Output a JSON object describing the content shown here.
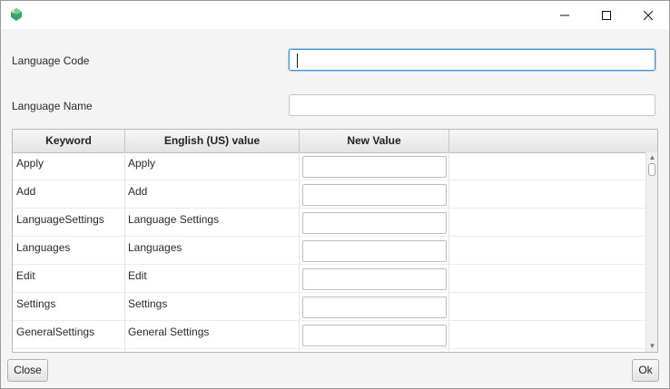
{
  "window": {
    "app_icon": "tree-icon",
    "controls": [
      "minimize-icon",
      "maximize-icon",
      "close-icon"
    ]
  },
  "form": {
    "code_label": "Language Code",
    "code_value": "",
    "name_label": "Language Name",
    "name_value": ""
  },
  "table": {
    "headers": [
      "Keyword",
      "English (US) value",
      "New Value",
      ""
    ],
    "rows": [
      {
        "keyword": "Apply",
        "english": "Apply",
        "new_value": ""
      },
      {
        "keyword": "Add",
        "english": "Add",
        "new_value": ""
      },
      {
        "keyword": "LanguageSettings",
        "english": "Language Settings",
        "new_value": ""
      },
      {
        "keyword": "Languages",
        "english": "Languages",
        "new_value": ""
      },
      {
        "keyword": "Edit",
        "english": "Edit",
        "new_value": ""
      },
      {
        "keyword": "Settings",
        "english": "Settings",
        "new_value": ""
      },
      {
        "keyword": "GeneralSettings",
        "english": "General Settings",
        "new_value": ""
      }
    ]
  },
  "buttons": {
    "close_label": "Close",
    "ok_label": "Ok"
  }
}
